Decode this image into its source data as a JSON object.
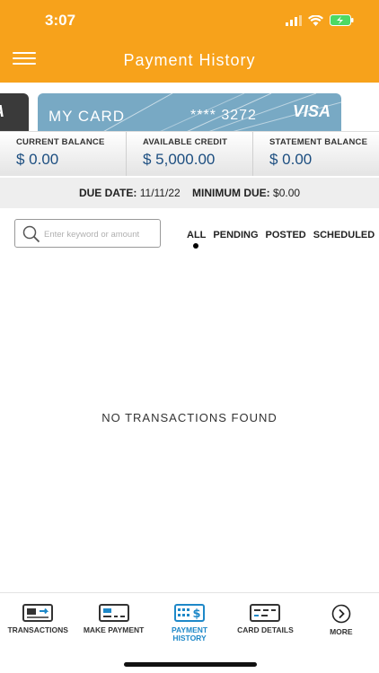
{
  "status_bar": {
    "time": "3:07"
  },
  "header": {
    "title": "Payment History",
    "menu_icon": "hamburger-icon"
  },
  "cards": {
    "prev_card_brand": "SA",
    "main": {
      "name": "MY CARD",
      "number": "**** 3272",
      "brand": "VISA",
      "color": "#78a9c4"
    }
  },
  "balances": [
    {
      "label": "CURRENT BALANCE",
      "value": "$ 0.00"
    },
    {
      "label": "AVAILABLE CREDIT",
      "value": "$ 5,000.00"
    },
    {
      "label": "STATEMENT BALANCE",
      "value": "$ 0.00"
    }
  ],
  "due": {
    "due_date_label": "DUE DATE:",
    "due_date_value": "11/11/22",
    "min_due_label": "MINIMUM DUE:",
    "min_due_value": "$0.00"
  },
  "search": {
    "placeholder": "Enter keyword or amount",
    "value": ""
  },
  "filters": [
    "ALL",
    "PENDING",
    "POSTED",
    "SCHEDULED"
  ],
  "selected_filter": "ALL",
  "empty_message": "NO TRANSACTIONS FOUND",
  "nav": [
    {
      "label": "TRANSACTIONS",
      "icon": "transactions-icon"
    },
    {
      "label": "MAKE PAYMENT",
      "icon": "make-payment-icon"
    },
    {
      "label": "PAYMENT HISTORY",
      "icon": "payment-history-icon",
      "active": true
    },
    {
      "label": "CARD DETAILS",
      "icon": "card-details-icon"
    },
    {
      "label": "MORE",
      "icon": "more-icon"
    }
  ],
  "colors": {
    "header": "#F7A21B",
    "accent": "#1e88c8",
    "balance_value": "#1c4e80"
  }
}
